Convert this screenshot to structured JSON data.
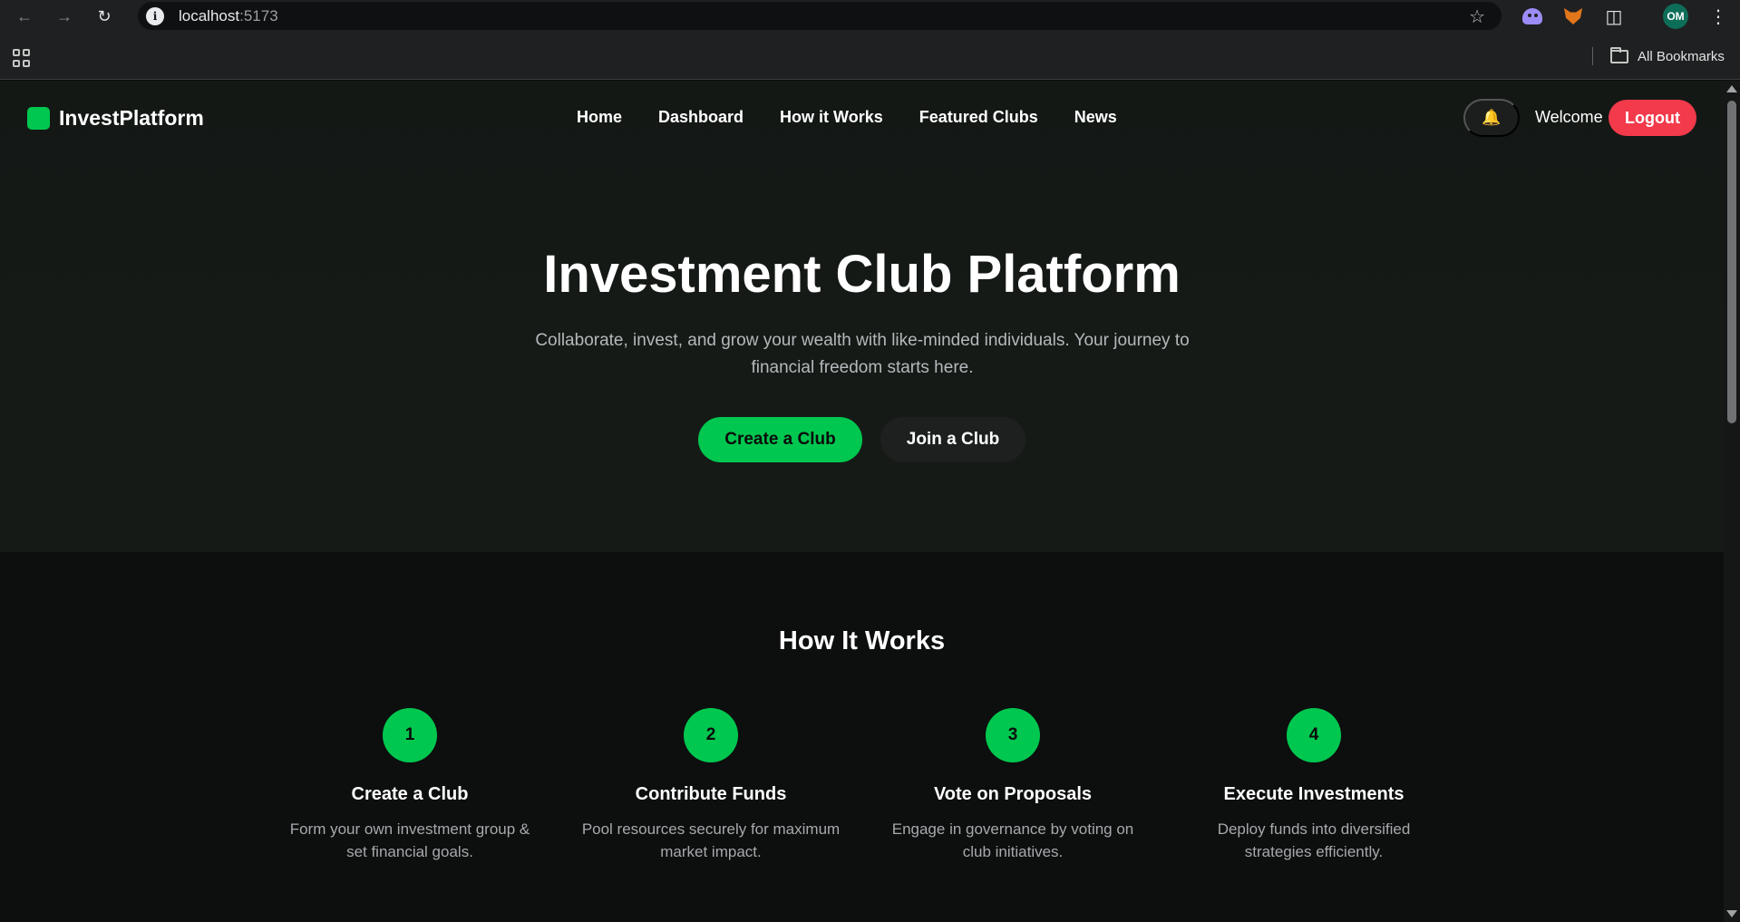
{
  "browser": {
    "url_host": "localhost",
    "url_port": ":5173",
    "profile_initials": "OM",
    "bookmarks_label": "All Bookmarks"
  },
  "nav": {
    "brand": "InvestPlatform",
    "links": [
      "Home",
      "Dashboard",
      "How it Works",
      "Featured Clubs",
      "News"
    ],
    "bell_icon": "🔔",
    "welcome": "Welcome",
    "logout": "Logout"
  },
  "hero": {
    "title": "Investment Club Platform",
    "subtitle": "Collaborate, invest, and grow your wealth with like-minded individuals. Your journey to financial freedom starts here.",
    "primary_button": "Create a Club",
    "secondary_button": "Join a Club"
  },
  "how_it_works": {
    "title": "How It Works",
    "steps": [
      {
        "number": "1",
        "title": "Create a Club",
        "description": "Form your own investment group & set financial goals."
      },
      {
        "number": "2",
        "title": "Contribute Funds",
        "description": "Pool resources securely for maximum market impact."
      },
      {
        "number": "3",
        "title": "Vote on Proposals",
        "description": "Engage in governance by voting on club initiatives."
      },
      {
        "number": "4",
        "title": "Execute Investments",
        "description": "Deploy funds into diversified strategies efficiently."
      }
    ]
  },
  "colors": {
    "accent": "#00c74f",
    "logout": "#f23a4b",
    "background": "#0d0e0e"
  }
}
